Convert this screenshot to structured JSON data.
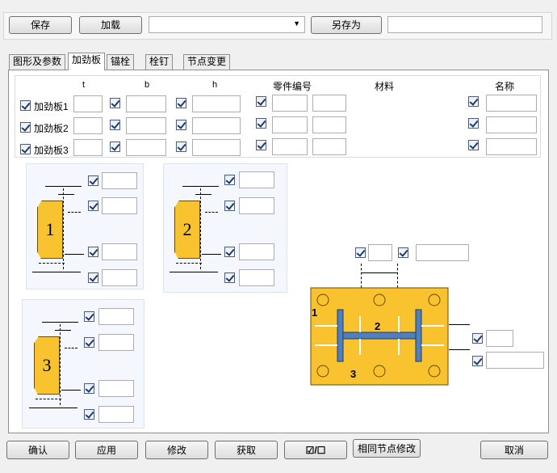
{
  "toolbar": {
    "save": "保存",
    "load": "加载",
    "save_as": "另存为",
    "preset_value": "",
    "name_value": ""
  },
  "tabs": [
    "图形及参数",
    "加劲板",
    "锚栓",
    "栓钉",
    "节点变更"
  ],
  "table": {
    "headers": {
      "t": "t",
      "b": "b",
      "h": "h",
      "part_no": "零件编号",
      "material": "材料",
      "name": "名称"
    },
    "rows": [
      {
        "label": "加劲板1"
      },
      {
        "label": "加劲板2"
      },
      {
        "label": "加劲板3"
      }
    ]
  },
  "diagrams": {
    "plate1": "1",
    "plate2": "2",
    "plate3": "3",
    "section_labels": [
      "1",
      "2",
      "3"
    ]
  },
  "footer": {
    "ok": "确认",
    "apply": "应用",
    "modify": "修改",
    "get": "获取",
    "toggle": "☑/☐",
    "same_node_modify": "相同节点修改",
    "cancel": "取消"
  },
  "colors": {
    "plate_fill": "#f9c22f",
    "panel_bg": "#f4f8fe"
  }
}
